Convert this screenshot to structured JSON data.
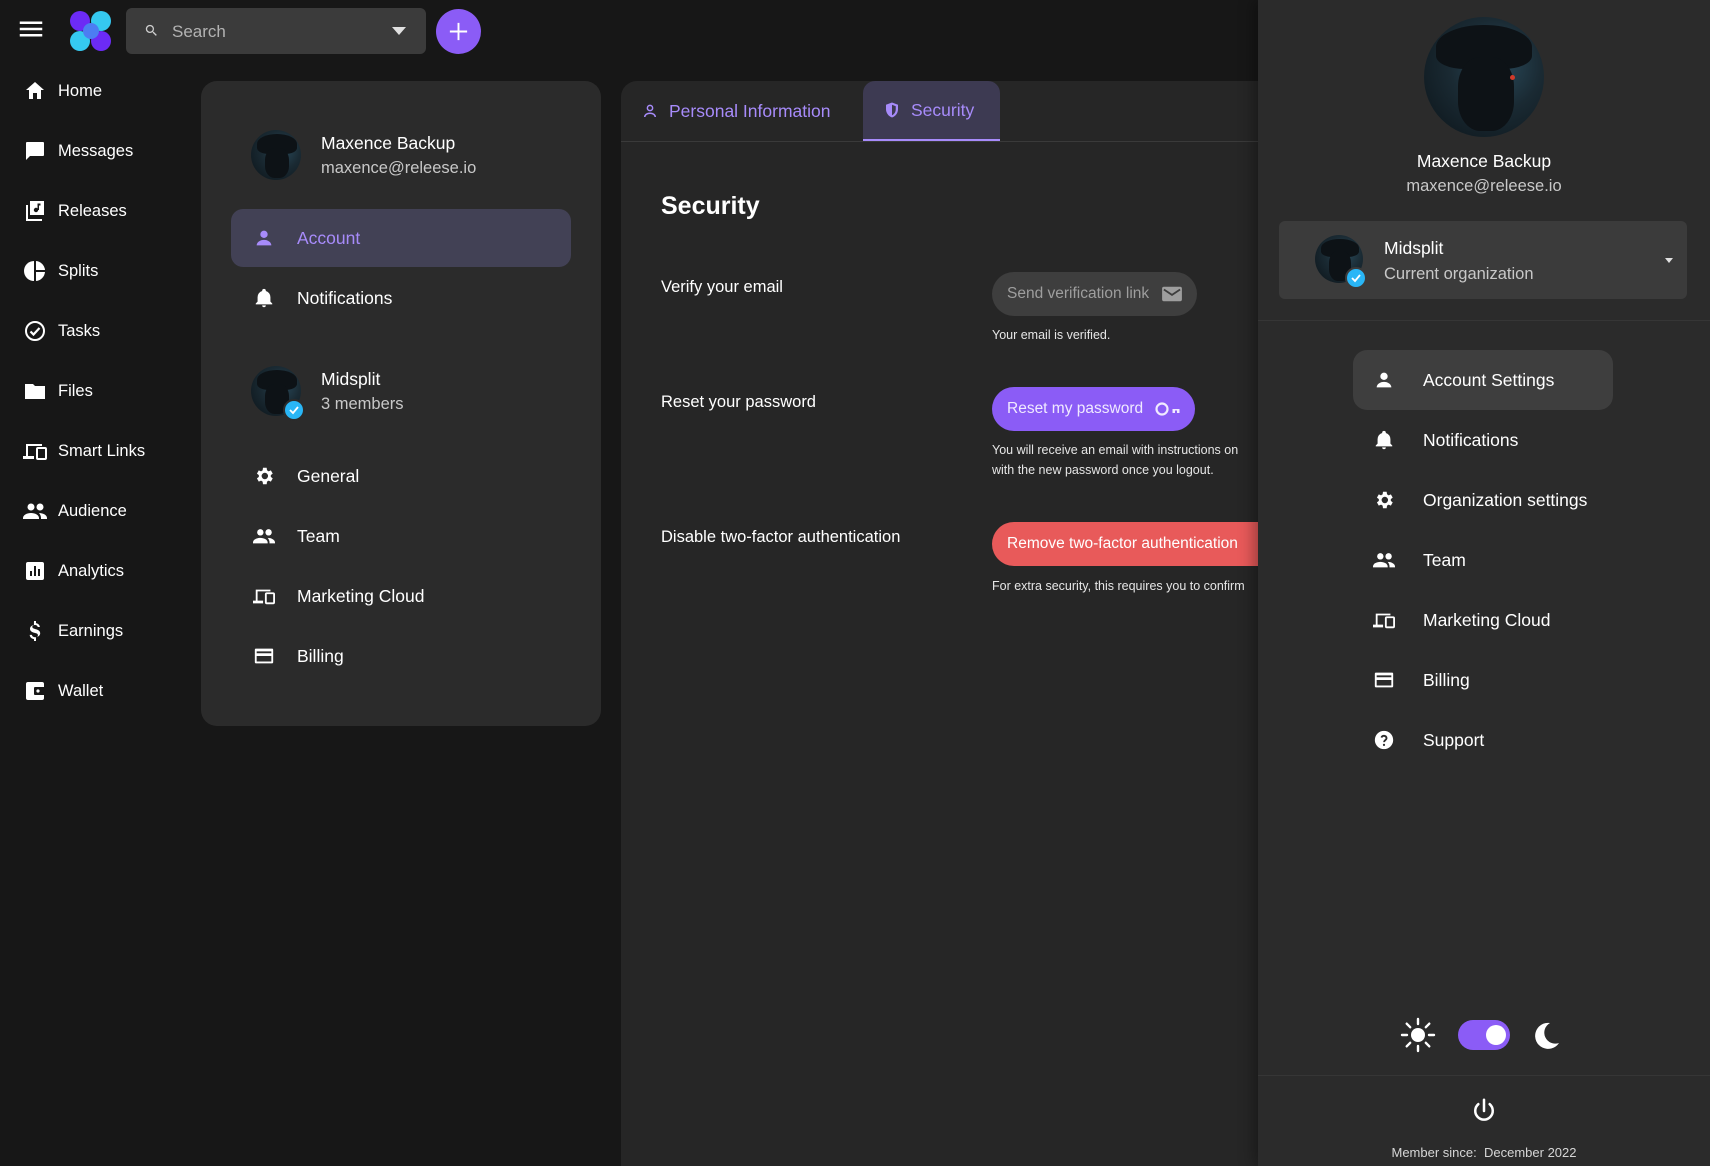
{
  "colors": {
    "accent": "#8b5cf6",
    "accent_text": "#a78bfa",
    "danger": "#e85a5a",
    "verified": "#29b6f6"
  },
  "topbar": {
    "search_placeholder": "Search"
  },
  "nav": {
    "items": [
      {
        "label": "Home",
        "icon": "home-icon"
      },
      {
        "label": "Messages",
        "icon": "messages-icon"
      },
      {
        "label": "Releases",
        "icon": "releases-icon"
      },
      {
        "label": "Splits",
        "icon": "splits-icon"
      },
      {
        "label": "Tasks",
        "icon": "tasks-icon"
      },
      {
        "label": "Files",
        "icon": "folder-icon"
      },
      {
        "label": "Smart Links",
        "icon": "devices-icon"
      },
      {
        "label": "Audience",
        "icon": "people-icon"
      },
      {
        "label": "Analytics",
        "icon": "analytics-icon"
      },
      {
        "label": "Earnings",
        "icon": "dollar-icon"
      },
      {
        "label": "Wallet",
        "icon": "wallet-icon"
      }
    ]
  },
  "settings_card": {
    "user": {
      "name": "Maxence Backup",
      "email": "maxence@releese.io"
    },
    "account_items": [
      {
        "label": "Account",
        "icon": "person-icon",
        "active": true
      },
      {
        "label": "Notifications",
        "icon": "bell-icon",
        "active": false
      }
    ],
    "org": {
      "name": "Midsplit",
      "members": "3 members"
    },
    "org_items": [
      {
        "label": "General",
        "icon": "gear-icon"
      },
      {
        "label": "Team",
        "icon": "team-icon"
      },
      {
        "label": "Marketing Cloud",
        "icon": "devices-icon"
      },
      {
        "label": "Billing",
        "icon": "credit-card-icon"
      }
    ]
  },
  "main": {
    "tabs": [
      {
        "label": "Personal Information",
        "icon": "person-outline-icon",
        "active": false
      },
      {
        "label": "Security",
        "icon": "shield-icon",
        "active": true
      }
    ],
    "title": "Security",
    "rows": {
      "verify": {
        "label": "Verify your email",
        "button": "Send verification link",
        "helper": "Your email is verified."
      },
      "reset": {
        "label": "Reset your password",
        "button": "Reset my password",
        "helper1": "You will receive an email with instructions on",
        "helper2": "with the new password once you logout."
      },
      "twofa": {
        "label": "Disable two-factor authentication",
        "button": "Remove two-factor authentication",
        "helper": "For extra security, this requires you to confirm"
      }
    }
  },
  "drawer": {
    "name": "Maxence Backup",
    "email": "maxence@releese.io",
    "org": {
      "name": "Midsplit",
      "sub": "Current organization"
    },
    "items": [
      {
        "label": "Account Settings",
        "icon": "person-icon",
        "active": true
      },
      {
        "label": "Notifications",
        "icon": "bell-icon",
        "active": false
      },
      {
        "label": "Organization settings",
        "icon": "gear-icon",
        "active": false
      },
      {
        "label": "Team",
        "icon": "team-icon",
        "active": false
      },
      {
        "label": "Marketing Cloud",
        "icon": "devices-icon",
        "active": false
      },
      {
        "label": "Billing",
        "icon": "credit-card-icon",
        "active": false
      },
      {
        "label": "Support",
        "icon": "help-icon",
        "active": false
      }
    ],
    "theme": "dark",
    "member_since_label": "Member since:",
    "member_since_value": "December 2022"
  }
}
